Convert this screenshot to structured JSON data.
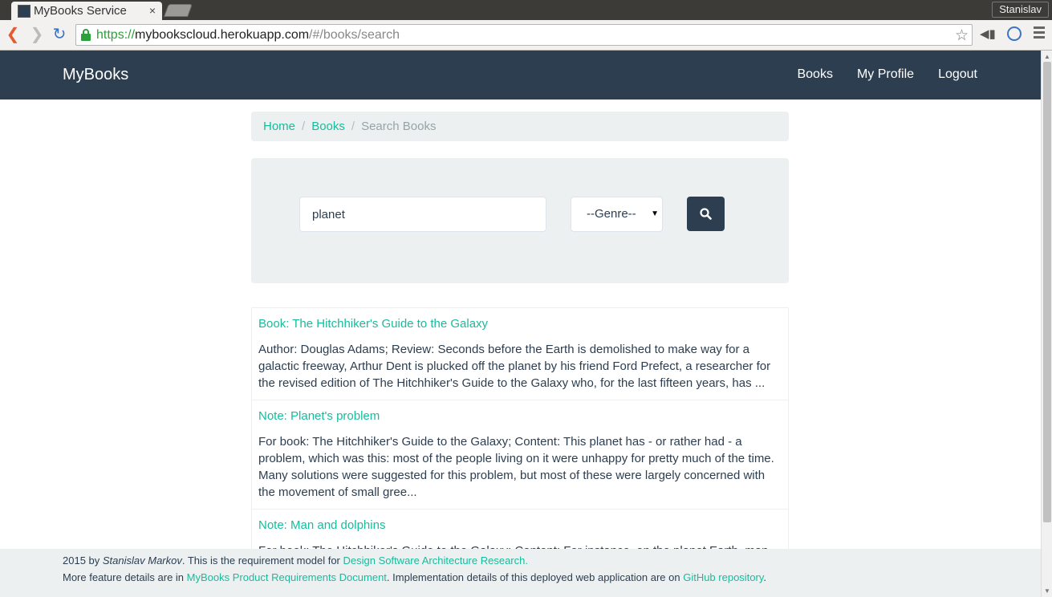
{
  "browser": {
    "tab_title": "MyBooks Service",
    "tab_close": "×",
    "user_name": "Stanislav",
    "url_scheme": "https://",
    "url_host": "mybookscloud.herokuapp.com",
    "url_path": "/#/books/search",
    "icons": [
      "back-icon",
      "forward-icon",
      "reload-icon",
      "lock-icon",
      "star-icon",
      "menu-icon"
    ]
  },
  "navbar": {
    "brand": "MyBooks",
    "links": [
      "Books",
      "My Profile",
      "Logout"
    ],
    "color": "#2c3e50"
  },
  "breadcrumb": {
    "home": "Home",
    "books": "Books",
    "current": "Search Books",
    "separator": "/"
  },
  "search": {
    "query": "planet",
    "genre_selected": "--Genre--"
  },
  "results": [
    {
      "title": "Book: The Hitchhiker's Guide to the Galaxy",
      "text": "Author: Douglas Adams; Review: Seconds before the Earth is demolished to make way for a galactic freeway, Arthur Dent is plucked off the planet by his friend Ford Prefect, a researcher for the revised edition of The Hitchhiker's Guide to the Galaxy who, for the last fifteen years, has ..."
    },
    {
      "title": "Note: Planet's problem",
      "text": "For book: The Hitchhiker's Guide to the Galaxy; Content: This planet has - or rather had - a problem, which was this: most of the people living on it were unhappy for pretty much of the time. Many solutions were suggested for this problem, but most of these were largely concerned with the movement of small gree..."
    },
    {
      "title": "Note: Man and dolphins",
      "text": "For book: The Hitchhiker's Guide to the Galaxy; Content: For instance, on the planet Earth, man"
    }
  ],
  "footer": {
    "line1_prefix": "2015 by ",
    "line1_author": "Stanislav Markov",
    "line1_mid": ". This is the requirement model for ",
    "line1_link": "Design Software Architecture Research.",
    "line2_prefix": "More feature details are in ",
    "line2_link1": "MyBooks Product Requirements Document",
    "line2_mid": ". Implementation details of this deployed web application are on ",
    "line2_link2": "GitHub repository",
    "line2_suffix": "."
  },
  "colors": {
    "accent": "#18bc9c",
    "dark": "#2c3e50",
    "light": "#ecf0f1"
  }
}
